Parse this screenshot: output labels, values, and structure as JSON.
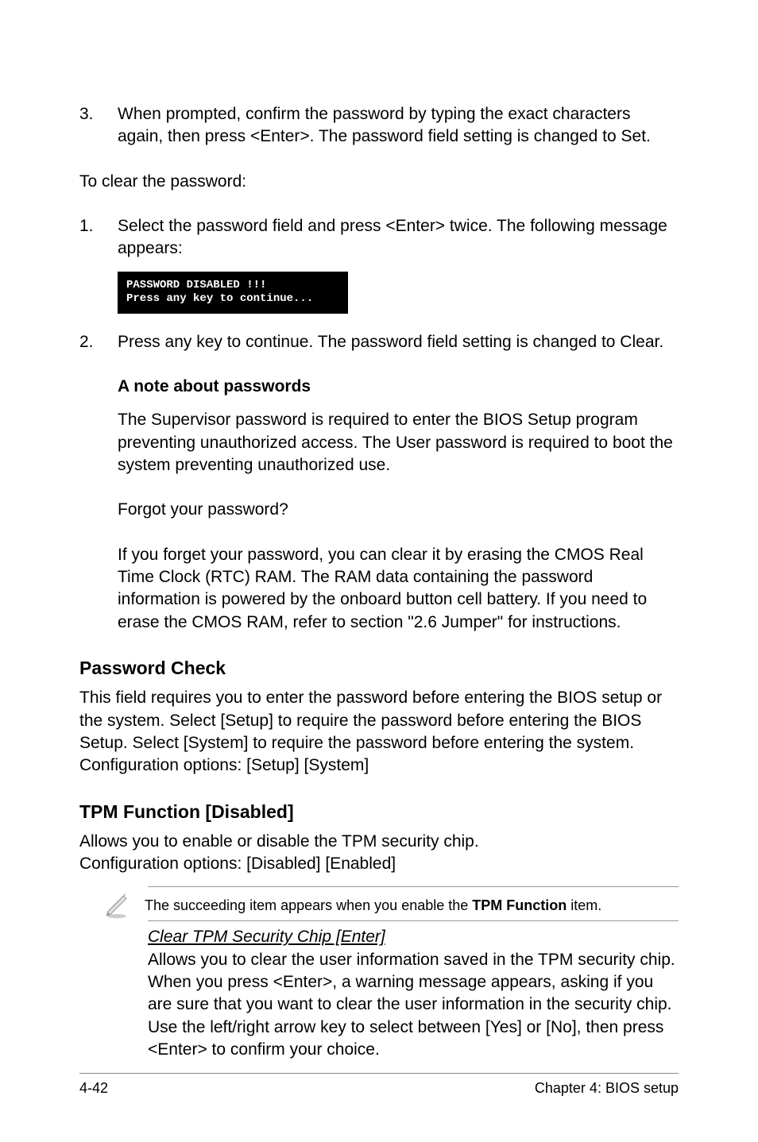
{
  "step3": {
    "num": "3.",
    "text": "When prompted, confirm the password by typing the exact characters again, then press <Enter>. The password field setting is changed to Set."
  },
  "clear_intro": "To clear the password:",
  "step1": {
    "num": "1.",
    "text": "Select the password field and press <Enter> twice. The following message appears:"
  },
  "terminal": {
    "line1": "PASSWORD DISABLED !!!",
    "line2": "Press any key to continue..."
  },
  "step2": {
    "num": "2.",
    "text": "Press any key to continue. The password field setting is changed to Clear."
  },
  "note_passwords": {
    "heading": "A note about passwords",
    "p1": "The Supervisor password is required to enter the BIOS Setup program preventing unauthorized access. The User password is required to boot the system preventing unauthorized use.",
    "p2": "Forgot your password?",
    "p3": "If you forget your password, you can clear it by erasing the CMOS Real Time Clock (RTC) RAM. The RAM data containing the password information is powered by the onboard button cell battery. If you need to erase the CMOS RAM, refer to section \"2.6 Jumper\" for instructions."
  },
  "password_check": {
    "heading": "Password Check",
    "body": "This field requires you to enter the password before entering the BIOS setup or the system. Select [Setup] to require the password before entering the BIOS Setup. Select [System] to require the password before entering the system. Configuration options: [Setup] [System]"
  },
  "tpm": {
    "heading": "TPM Function [Disabled]",
    "body1": "Allows you to enable or disable the TPM security chip.",
    "body2": "Configuration options: [Disabled] [Enabled]"
  },
  "tpm_note": {
    "pre": "The succeeding item appears when you enable the ",
    "bold": "TPM Function",
    "post": " item."
  },
  "clear_tpm": {
    "heading": "Clear TPM Security Chip [Enter]",
    "body": "Allows you to clear the user information saved in the TPM security chip. When you press <Enter>, a warning message appears, asking if you are sure that you want to clear the user information in the security chip. Use the left/right arrow key to select between [Yes] or [No], then press <Enter> to confirm your choice."
  },
  "footer": {
    "left": "4-42",
    "right": "Chapter 4: BIOS setup"
  }
}
